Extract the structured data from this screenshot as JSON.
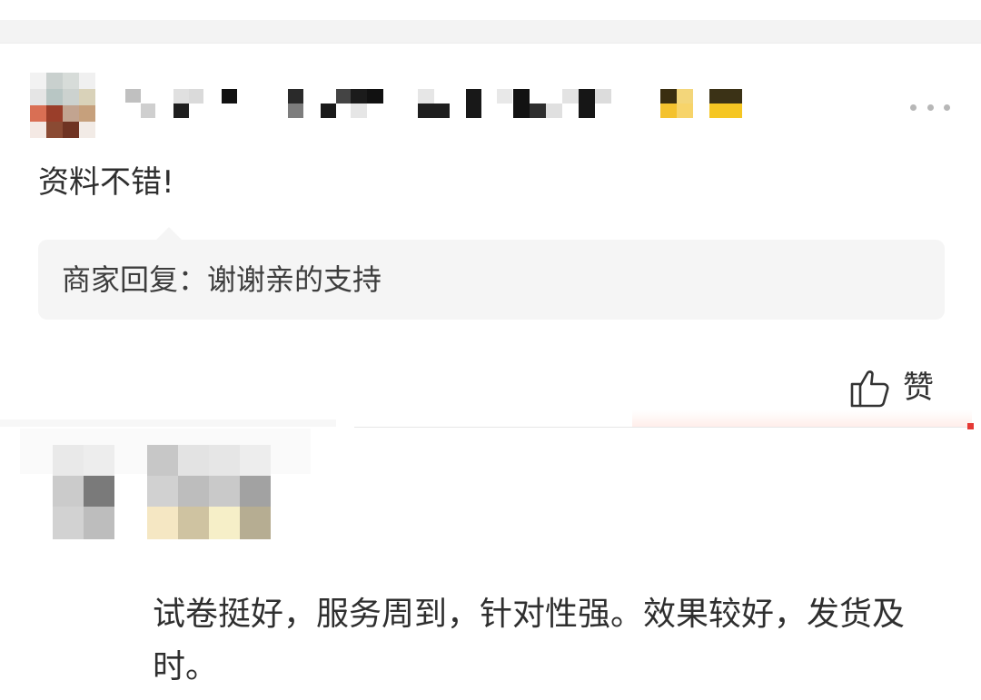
{
  "reviews": [
    {
      "text": "资料不错!",
      "merchant_reply": "商家回复：谢谢亲的支持",
      "like_label": "赞"
    },
    {
      "text": "试卷挺好，服务周到，针对性强。效果较好，发货及时。"
    }
  ],
  "icons": {
    "more": "more-dots-icon",
    "like": "thumbs-up-icon"
  },
  "colors": {
    "reply_background": "#f5f5f5",
    "accent": "#e53935",
    "text": "#2f2f2f"
  }
}
